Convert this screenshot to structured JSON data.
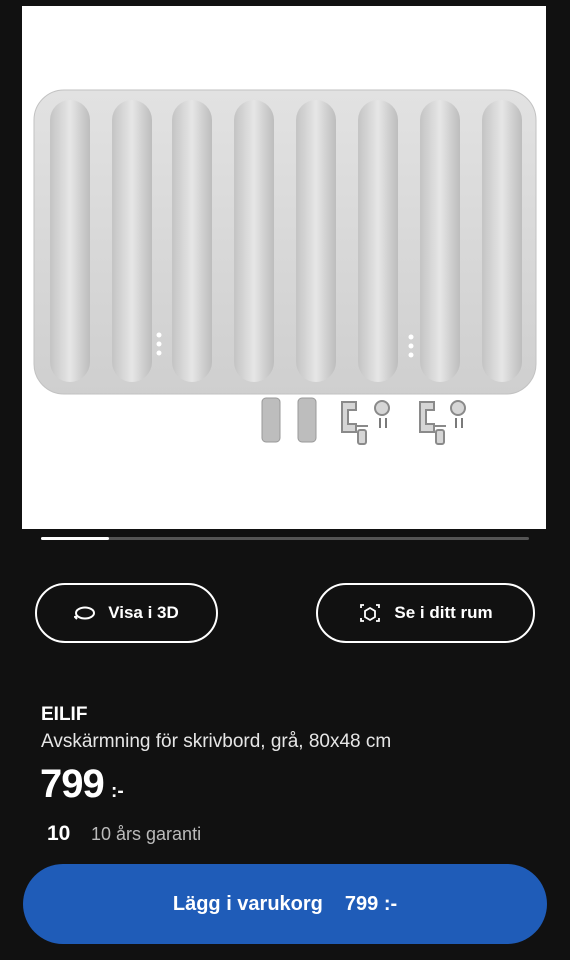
{
  "product_image": {
    "alt": "",
    "background": "#ffffff",
    "panel_color": "#d9d9d9"
  },
  "carousel": {
    "progress": 0.14
  },
  "buttons": {
    "view_3d": {
      "label": "Visa i 3D",
      "icon": "rotate-3d-icon"
    },
    "view_in_room": {
      "label": "Se i ditt rum",
      "icon": "ar-cube-icon"
    }
  },
  "product": {
    "name": "EILIF",
    "description": "Avskärmning för skrivbord, grå, 80x48 cm",
    "price": "799",
    "price_suffix": ":-"
  },
  "warranty": {
    "years": "10",
    "text": "10 års garanti"
  },
  "cart": {
    "label": "Lägg i varukorg",
    "price": "799 :-",
    "color": "#1f5cb8"
  }
}
